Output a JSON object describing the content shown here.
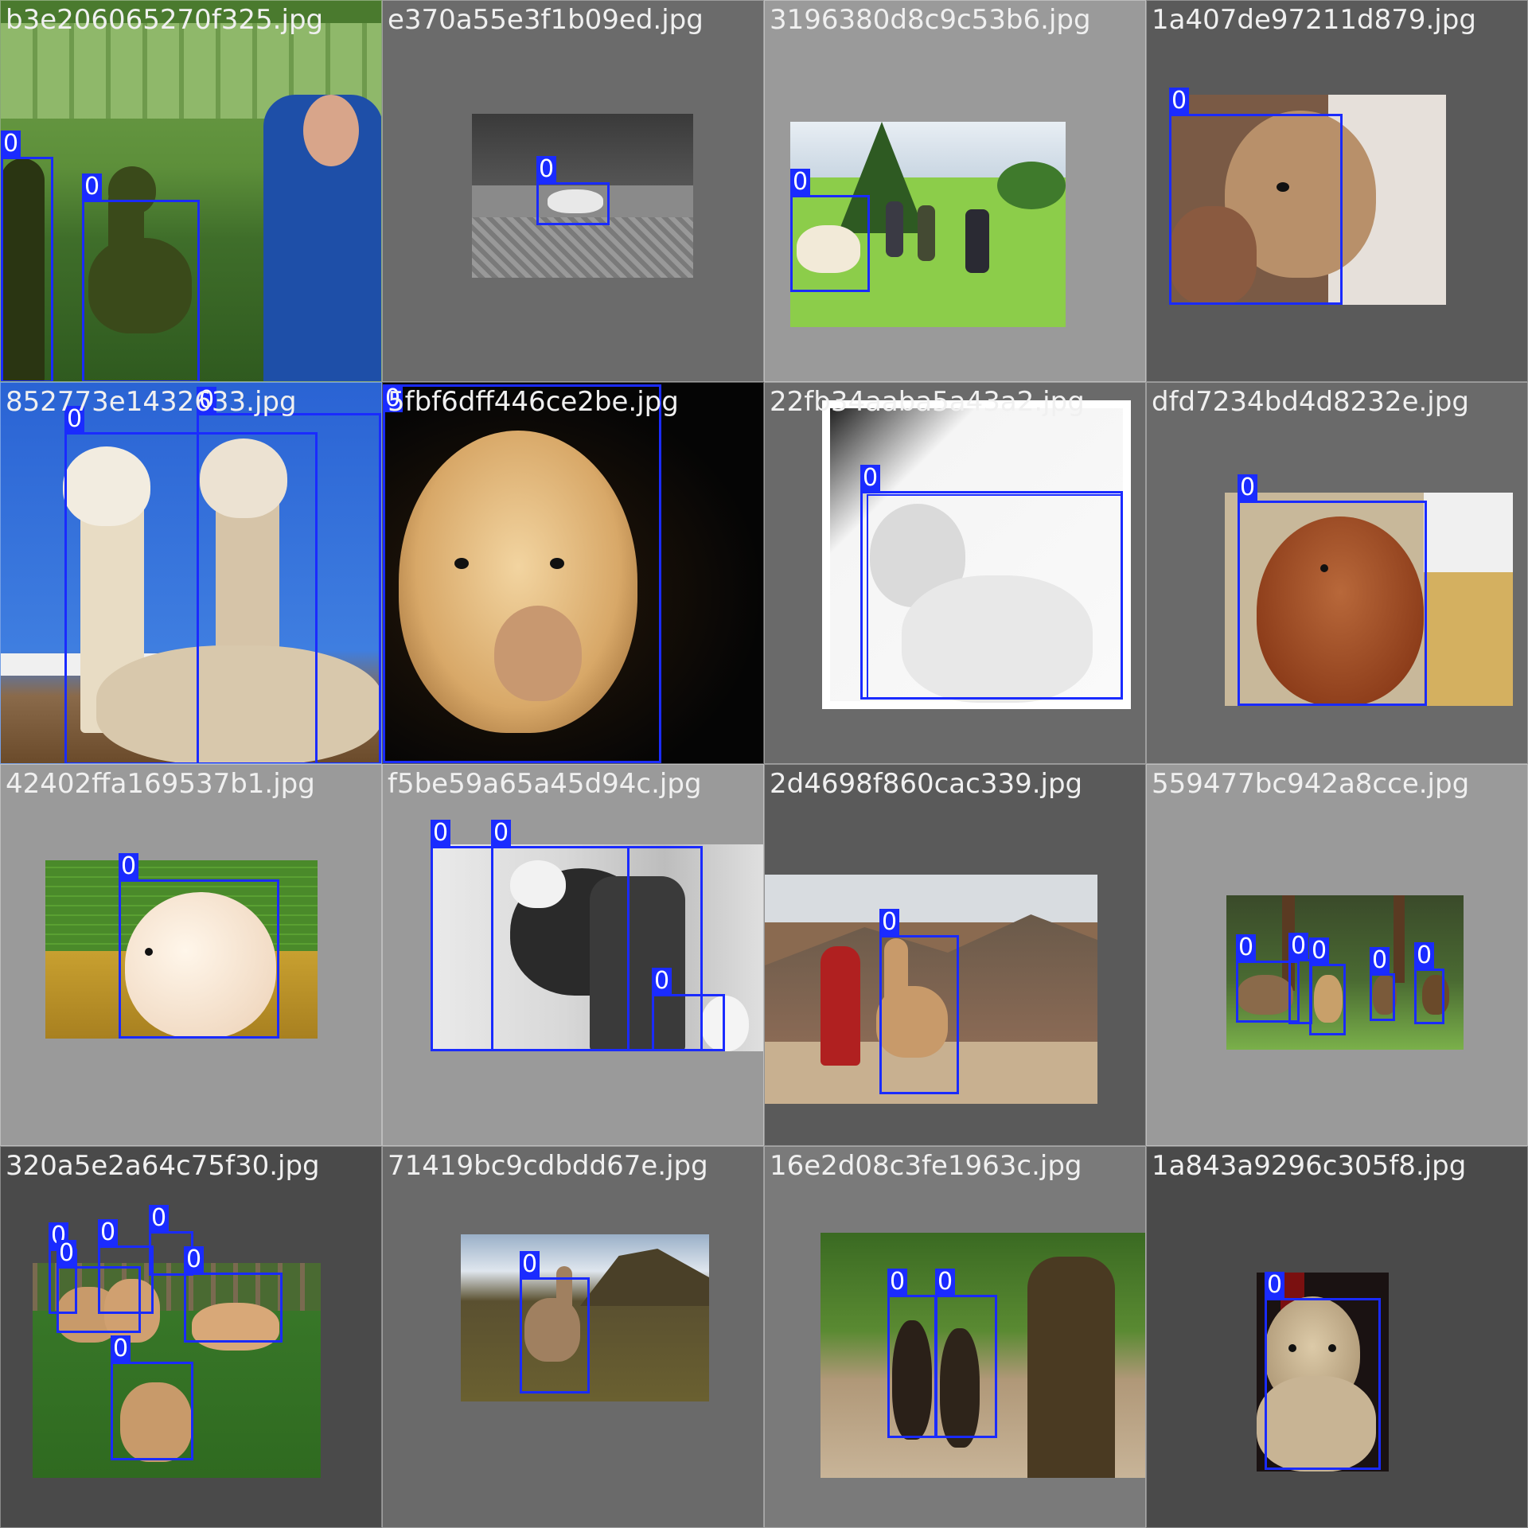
{
  "tiles": [
    {
      "filename": "b3e206065270f325.jpg",
      "labels": [
        "0",
        "0"
      ]
    },
    {
      "filename": "e370a55e3f1b09ed.jpg",
      "labels": [
        "0"
      ]
    },
    {
      "filename": "3196380d8c9c53b6.jpg",
      "labels": [
        "0"
      ]
    },
    {
      "filename": "1a407de97211d879.jpg",
      "labels": [
        "0"
      ]
    },
    {
      "filename": "852773e1432‌633.jpg",
      "labels": [
        "0",
        "0"
      ]
    },
    {
      "filename": "5fbf6dff446ce2be.jpg",
      "labels": [
        "0"
      ]
    },
    {
      "filename": "22fb34aaba5a43a2.jpg",
      "labels": [
        "0"
      ]
    },
    {
      "filename": "dfd7234bd4d8232e.jpg",
      "labels": [
        "0"
      ]
    },
    {
      "filename": "42402ffa169537b1.jpg",
      "labels": [
        "0"
      ]
    },
    {
      "filename": "f5be59a65a45d94c.jpg",
      "labels": [
        "0",
        "0",
        "0"
      ]
    },
    {
      "filename": "2d4698f860cac339.jpg",
      "labels": [
        "0"
      ]
    },
    {
      "filename": "559477bc942a8cce.jpg",
      "labels": [
        "0",
        "0",
        "0",
        "0",
        "0"
      ]
    },
    {
      "filename": "320a5e2a64c75f30.jpg",
      "labels": [
        "0",
        "0",
        "0",
        "0",
        "0",
        "0"
      ]
    },
    {
      "filename": "71419bc9cdbdd67e.jpg",
      "labels": [
        "0"
      ]
    },
    {
      "filename": "16e2d08c3fe1963c.jpg",
      "labels": [
        "0",
        "0"
      ]
    },
    {
      "filename": "1a843a9296c305f8.jpg",
      "labels": [
        "0"
      ]
    }
  ],
  "colors": {
    "box": "#1a2bff",
    "label_bg": "#1a2bff",
    "label_text": "#ffffff",
    "filename_text": "#f0f0f0"
  }
}
